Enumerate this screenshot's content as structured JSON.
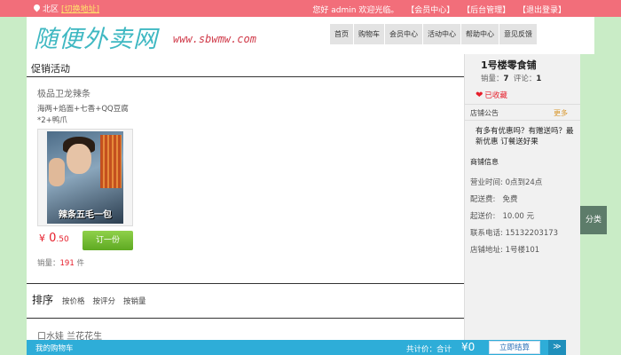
{
  "topbar": {
    "location": "北区",
    "switch_label": "[切换地址]",
    "greeting": "您好 admin 欢迎光临。",
    "links": [
      "【会员中心】",
      "【后台管理】",
      "【退出登录】"
    ]
  },
  "header": {
    "logo": "随便外卖网",
    "domain": "www.sbwmw.com",
    "nav": [
      "首页",
      "购物车",
      "会员中心",
      "活动中心",
      "帮助中心",
      "意见反馈"
    ]
  },
  "main": {
    "section_title": "促销活动",
    "promo": {
      "name": "极品卫龙辣条",
      "desc": "海两+焰面+七香+QQ豆腐*2+鸭爪",
      "image_caption": "辣条五毛一包",
      "price_symbol": "¥",
      "price_int": "0",
      "price_dec": ".50",
      "order_button": "订一份",
      "sales_label": "销量：",
      "sales_count": "191",
      "sales_unit": "件"
    },
    "sort": {
      "label": "排序",
      "options": [
        "按价格",
        "按评分",
        "按销量"
      ]
    },
    "next_item": "口水娃 兰花花生"
  },
  "sidebar": {
    "shop_name": "1号楼零食铺",
    "stats_sales_label": "销量：",
    "stats_sales": "7",
    "stats_reviews_label": "评论：",
    "stats_reviews": "1",
    "favorite": "已收藏",
    "notice_label": "店铺公告",
    "notice_more": "更多",
    "notice_text": "有多有优惠吗？有赠送吗？最新优惠 订餐送好果",
    "info_title": "商铺信息",
    "info": [
      {
        "label": "营业时间:",
        "value": "0点到24点"
      },
      {
        "label": "配送费:",
        "value": "免费"
      },
      {
        "label": "起送价:",
        "value": "10.00 元"
      },
      {
        "label": "联系电话:",
        "value": "15132203173"
      },
      {
        "label": "店铺地址:",
        "value": "1号楼101"
      }
    ]
  },
  "category_tab": "分类",
  "cartbar": {
    "title": "我的购物车",
    "total_label": "共计价：合计",
    "total": "¥0",
    "checkout": "立即结算",
    "up": "≫"
  },
  "colors": {
    "topbar": "#f26e7a",
    "accent_cyan": "#3fb8c2",
    "price_red": "#e61e2b",
    "order_green": "#6fbe2e",
    "cartbar_blue": "#2eadd8",
    "page_bg": "#c9ecc6"
  }
}
